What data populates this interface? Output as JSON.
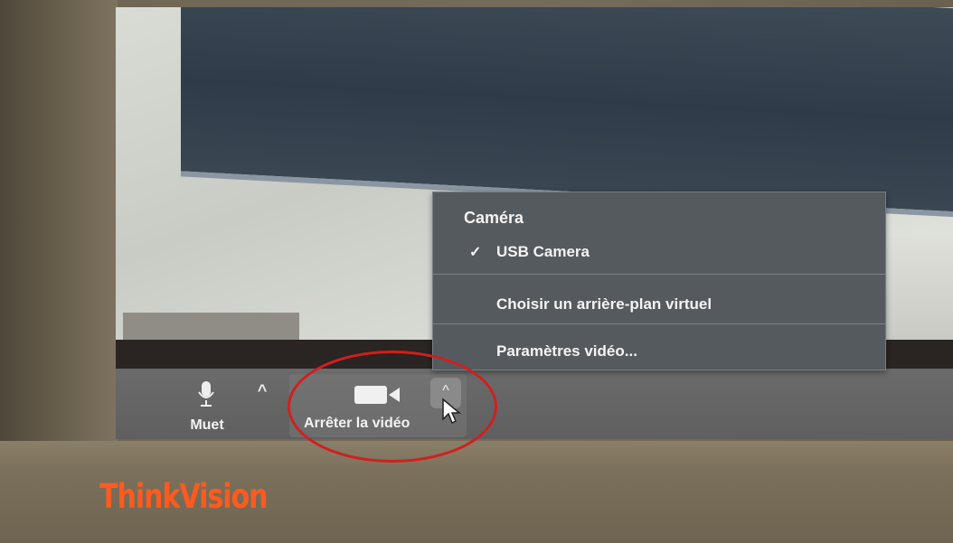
{
  "brand": {
    "label": "ThinkVision",
    "color": "#ff5a1f"
  },
  "toolbar": {
    "mute_label": "Muet",
    "mute_icon": "microphone-icon",
    "mute_caret": "^",
    "video_label": "Arrêter la vidéo",
    "video_icon": "video-camera-icon",
    "video_caret": "^"
  },
  "camera_menu": {
    "header": "Caméra",
    "items": [
      {
        "label": "USB Camera",
        "checked": true,
        "check_glyph": "✓"
      },
      {
        "label": "Choisir un arrière-plan virtuel",
        "checked": false
      },
      {
        "label": "Paramètres vidéo...",
        "checked": false
      }
    ]
  },
  "annotation": {
    "shape": "ellipse",
    "color": "#d11f1f"
  }
}
